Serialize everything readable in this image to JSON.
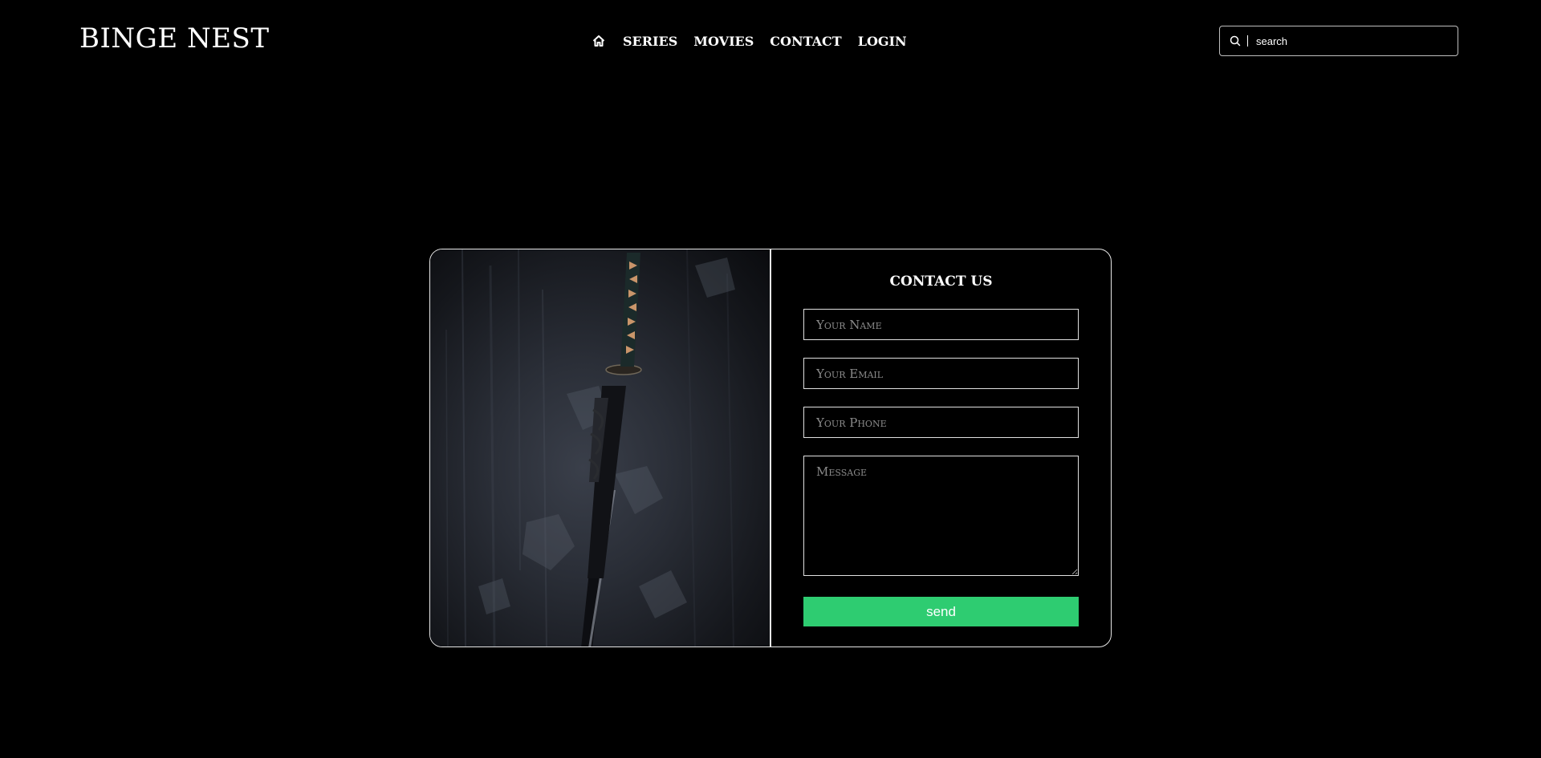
{
  "header": {
    "logo": "BINGE NEST",
    "nav": {
      "home_icon": "home-icon",
      "items": [
        {
          "label": "SERIES"
        },
        {
          "label": "MOVIES"
        },
        {
          "label": "CONTACT"
        },
        {
          "label": "LOGIN"
        }
      ]
    },
    "search": {
      "icon": "search-icon",
      "placeholder": "search"
    }
  },
  "contact": {
    "image": "katana-sword-image",
    "title": "CONTACT US",
    "fields": {
      "name_placeholder": "Your Name",
      "email_placeholder": "Your Email",
      "phone_placeholder": "Your Phone",
      "message_placeholder": "Message"
    },
    "send_label": "send"
  },
  "colors": {
    "background": "#000000",
    "text": "#ffffff",
    "accent": "#2ecc71",
    "border": "#e6e6e6"
  }
}
